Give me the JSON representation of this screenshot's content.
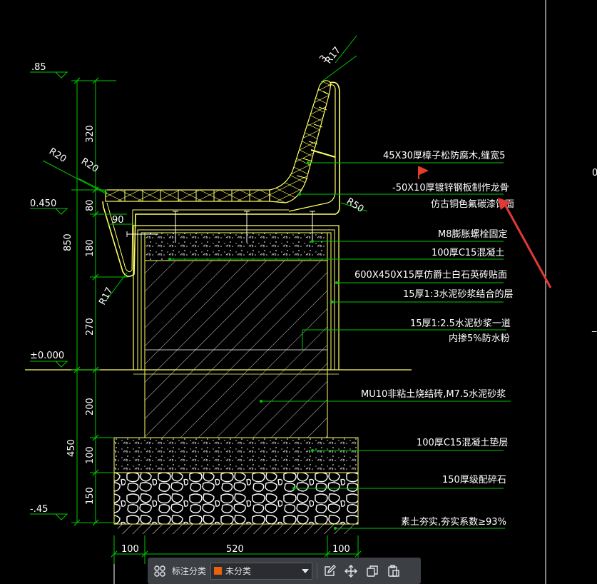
{
  "elevations": {
    "top": ".85",
    "seat": "0.450",
    "ground": "±0.000",
    "bottom": "-.45"
  },
  "vertical_dims": {
    "d320": "320",
    "d80": "80",
    "d850": "850",
    "d180": "180",
    "d270": "270",
    "d200": "200",
    "d450": "450",
    "d100": "100",
    "d150": "150"
  },
  "horizontal_dims": {
    "left": "100",
    "middle": "520",
    "right": "100"
  },
  "radii": {
    "r20a": "R20",
    "r20b": "R20",
    "r17top": "R17",
    "r50": "R50",
    "r17bottom": "R17",
    "d90": "90",
    "d3": "3"
  },
  "annotations": [
    "45X30厚樟子松防腐木,缝宽5",
    "-50X10厚镀锌钢板制作龙骨",
    "仿古铜色氟碳漆饰面",
    "M8膨胀螺栓固定",
    "100厚C15混凝土",
    "600X450X15厚仿爵士白石英砖贴面",
    "15厚1:3水泥砂浆结合的层",
    "15厚1:2.5水泥砂浆一道",
    "内掺5%防水粉",
    "MU10非粘土烧结砖,M7.5水泥砂浆",
    "100厚C15混凝土垫层",
    "150厚级配碎石",
    "素土夯实,夯实系数≥93%"
  ],
  "edge_text": {
    "c1": "0",
    "c2": "_"
  },
  "colors": {
    "background": "#000000",
    "leader": "#00c800",
    "structure": "#ffff66",
    "annotation_arrow": "#e53935",
    "flag": "#e53d2b",
    "toolbar_bg": "#3c3f44",
    "category_swatch": "#e8620c"
  },
  "toolbar": {
    "grid_icon": "grid-icon",
    "label": "标注分类",
    "category_selected": "未分类",
    "icons": [
      "edit-icon",
      "move-icon",
      "copy-icon",
      "paste-icon"
    ]
  }
}
